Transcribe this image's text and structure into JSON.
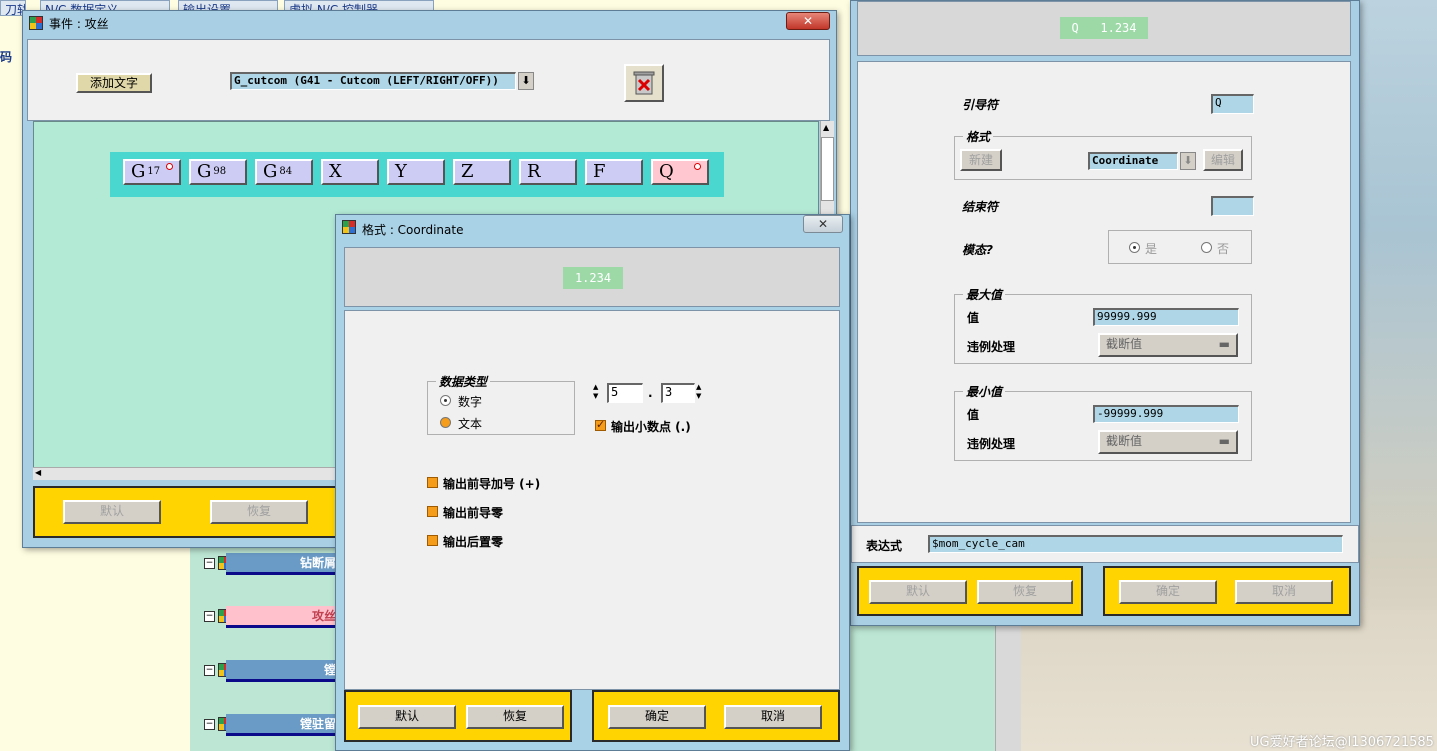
{
  "background": {
    "top_tabs": [
      "刀轨",
      "N/C 数据定义",
      "输出设置",
      "虚拟 N/C 控制器"
    ],
    "left_label": "码",
    "side_items": [
      {
        "label": "钻断屑"
      },
      {
        "label": "攻丝"
      },
      {
        "label": "镗"
      },
      {
        "label": "镗驻留"
      }
    ],
    "watermark": "UG爱好者论坛@l1306721585"
  },
  "event_window": {
    "title": "事件 : 攻丝",
    "close_symbol": "✕",
    "add_text_button": "添加文字",
    "dropdown_value": "G_cutcom (G41 - Cutcom (LEFT/RIGHT/OFF))",
    "dropdown_arrow": "⬇",
    "trash_icon": "trash-icon",
    "tokens": [
      {
        "main": "G",
        "sub": "17",
        "marker": true
      },
      {
        "main": "G",
        "sub": "98",
        "marker": false
      },
      {
        "main": "G",
        "sub": "84",
        "marker": false
      },
      {
        "main": "X",
        "sub": "",
        "marker": false
      },
      {
        "main": "Y",
        "sub": "",
        "marker": false
      },
      {
        "main": "Z",
        "sub": "",
        "marker": false
      },
      {
        "main": "R",
        "sub": "",
        "marker": false
      },
      {
        "main": "F",
        "sub": "",
        "marker": false
      },
      {
        "main": "Q",
        "sub": "",
        "marker": true
      }
    ],
    "bottom_buttons": [
      "默认",
      "恢复"
    ]
  },
  "address_window": {
    "preview": "Q   1.234",
    "leader_label": "引导符",
    "leader_value": "Q",
    "format_group": "格式",
    "new_button": "新建",
    "format_value": "Coordinate",
    "edit_button": "编辑",
    "trailer_label": "结束符",
    "trailer_value": "",
    "modal_label": "模态?",
    "modal_options": [
      "是",
      "否"
    ],
    "max_group": "最大值",
    "max_value_label": "值",
    "max_value": "99999.999",
    "max_violation_label": "违例处理",
    "max_violation_value": "截断值",
    "min_group": "最小值",
    "min_value_label": "值",
    "min_value": "-99999.999",
    "min_violation_label": "违例处理",
    "min_violation_value": "截断值",
    "expression_label": "表达式",
    "expression_value": "$mom_cycle_cam",
    "bottom_buttons": [
      "默认",
      "恢复",
      "确定",
      "取消"
    ]
  },
  "format_dialog": {
    "title": "格式 : Coordinate",
    "close_symbol": "✕",
    "preview": "1.234",
    "data_type_group": "数据类型",
    "data_type_options": [
      {
        "label": "数字",
        "selected": true
      },
      {
        "label": "文本",
        "selected": false
      }
    ],
    "integer_digits": "5",
    "decimal_separator": ".",
    "fraction_digits": "3",
    "output_decimal_point": "输出小数点 (.)",
    "output_decimal_point_checked": true,
    "checkboxes": [
      {
        "label": "输出前导加号 (+)",
        "checked": false
      },
      {
        "label": "输出前导零",
        "checked": false
      },
      {
        "label": "输出后置零",
        "checked": false
      }
    ],
    "default_button": "默认",
    "restore_button": "恢复",
    "ok_button": "确定",
    "cancel_button": "取消"
  }
}
